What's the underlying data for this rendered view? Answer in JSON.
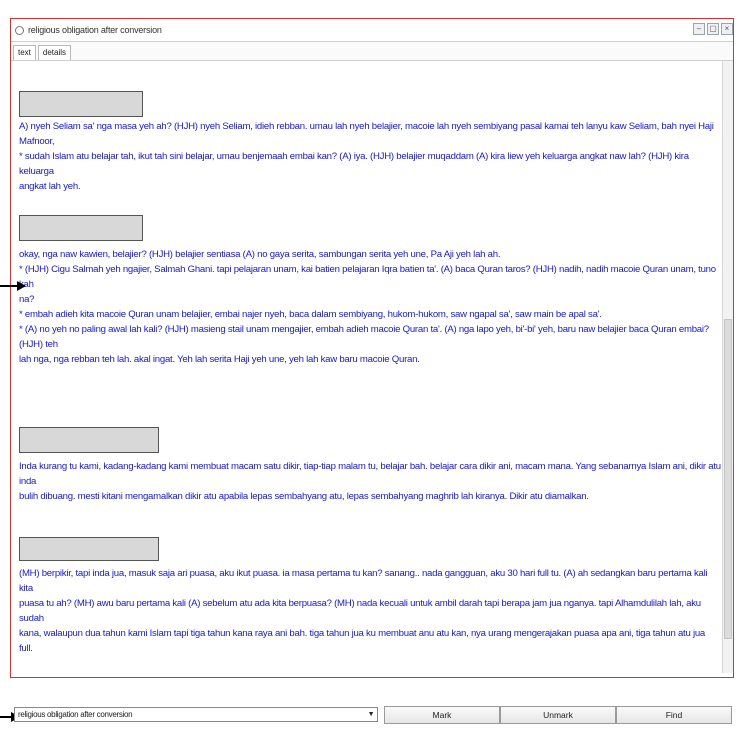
{
  "window": {
    "title": "religious obligation after conversion",
    "controls": [
      "–",
      "▢",
      "×"
    ]
  },
  "tabs": [
    {
      "label": "text",
      "active": true
    },
    {
      "label": "details",
      "active": false
    }
  ],
  "paragraphs": [
    {
      "lines": [
        "A) nyeh Seliam sa' nga masa yeh ah? (HJH) nyeh Seliam, idieh rebban. umau lah nyeh belajier, macoie lah nyeh sembiyang pasal kamai teh lanyu kaw Seliam, bah nyei Haji Mafnoor,",
        "* sudah Islam atu belajar tah, ikut tah sini belajar, umau benjemaah embai kan? (A) iya. (HJH) belajier muqaddam (A) kira liew yeh keluarga angkat naw lah? (HJH) kira keluarga",
        "angkat lah yeh."
      ]
    },
    {
      "lines": [
        "okay, nga naw kawien, belajier? (HJH) belajier sentiasa (A) no gaya serita, sambungan serita yeh une, Pa Aji yeh lah ah.",
        "* (HJH) Cigu Salmah yeh ngajier, Salmah Ghani. tapi pelajaran unam, kai batien pelajaran Iqra batien ta'. (A) baca Quran taros? (HJH) nadih, nadih macoie Quran unam, tuno kah",
        "na?",
        "* embah adieh kita macoie Quran unam belajier, embai najer nyeh, baca dalam sembiyang, hukom-hukom, saw ngapal sa', saw main be apal sa'.",
        "* (A) no yeh no paling awal lah kali? (HJH) masieng stail unam mengajier, embah adieh macoie Quran ta'. (A) nga lapo yeh, bi'-bi' yeh, baru naw belajier baca Quran embai? (HJH) teh",
        "lah nga, nga rebban teh lah. akal ingat. Yeh lah serita Haji yeh une, yeh lah kaw baru macoie Quran."
      ]
    },
    {
      "lines": [
        " Inda kurang tu kami, kadang-kadang kami membuat macam satu dikir, tiap-tiap malam tu, belajar bah. belajar cara dikir ani, macam mana. Yang sebanarnya Islam ani, dikir atu inda",
        "bulih dibuang. mesti kitani mengamalkan dikir atu apabila lepas sembahyang atu, lepas sembahyang maghrib lah kiranya. Dikir atu diamalkan."
      ]
    },
    {
      "lines": [
        "(MH) berpikir, tapi inda jua, masuk saja ari puasa, aku ikut puasa. ia masa pertama tu kan? sanang.. nada gangguan, aku 30 hari full tu. (A) ah sedangkan baru pertama kali kita",
        "puasa tu ah? (MH) awu baru pertama kali (A) sebelum atu ada kita berpuasa? (MH) nada kecuali untuk ambil darah tapi berapa jam jua nganya. tapi Alhamdulilah lah, aku sudah",
        "kana, walaupun dua tahun kami Islam tapi tiga tahun kana raya ani bah. tiga tahun jua ku membuat anu atu kan, nya urang mengerajakan puasa apa ani, tiga tahun atu jua full."
      ]
    }
  ],
  "bottom": {
    "select_value": "religious obligation after conversion",
    "mark_label": "Mark",
    "unmark_label": "Unmark",
    "find_label": "Find"
  },
  "colors": {
    "text": "#1818c8",
    "window_border": "#d83030"
  }
}
